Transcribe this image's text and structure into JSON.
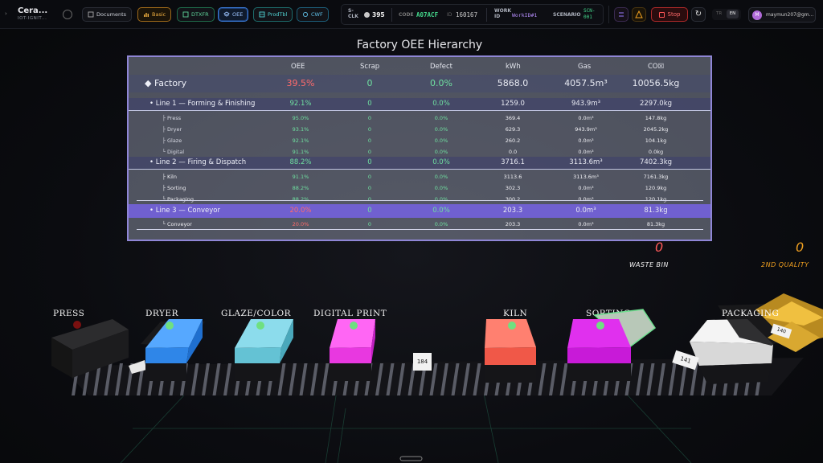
{
  "topbar": {
    "app_title": "Cera...",
    "app_subtitle": "IOT-IGNIT...",
    "buttons": {
      "documents": "Documents",
      "basic": "Basic",
      "dtxfr": "DTXFR",
      "oee": "OEE",
      "prodtbl": "ProdTbl",
      "cwf": "CWF"
    },
    "sclk_label": "S-\nCLK",
    "sclk_value": "395",
    "code_label": "CODE",
    "code_value": "A07ACF",
    "id_label": "ID",
    "id_value": "160167",
    "work_label": "WORK\nID",
    "work_value": "WorkID#1",
    "scenario_label": "SCENARIO",
    "scenario_value": "SCN-\n001",
    "stop_label": "Stop",
    "lang_tr": "TR",
    "lang_en": "EN",
    "avatar_initial": "M",
    "user_email": "maymun207@gm..."
  },
  "oee_table": {
    "title": "Factory OEE Hierarchy",
    "headers": [
      "OEE",
      "Scrap",
      "Defect",
      "kWh",
      "Gas",
      "CO☒"
    ],
    "rows": [
      {
        "kind": "factory",
        "name": "◆ Factory",
        "oee": "39.5%",
        "scrap": "0",
        "defect": "0.0%",
        "kwh": "5868.0",
        "gas": "4057.5m³",
        "co": "10056.5kg"
      },
      {
        "kind": "line",
        "name": "• Line 1 — Forming & Finishing",
        "oee": "92.1%",
        "scrap": "0",
        "defect": "0.0%",
        "kwh": "1259.0",
        "gas": "943.9m³",
        "co": "2297.0kg"
      },
      {
        "kind": "station",
        "name": "├ Press",
        "oee": "95.0%",
        "scrap": "0",
        "defect": "0.0%",
        "kwh": "369.4",
        "gas": "0.0m³",
        "co": "147.8kg"
      },
      {
        "kind": "station",
        "name": "├ Dryer",
        "oee": "93.1%",
        "scrap": "0",
        "defect": "0.0%",
        "kwh": "629.3",
        "gas": "943.9m³",
        "co": "2045.2kg"
      },
      {
        "kind": "station",
        "name": "├ Glaze",
        "oee": "92.1%",
        "scrap": "0",
        "defect": "0.0%",
        "kwh": "260.2",
        "gas": "0.0m³",
        "co": "104.1kg"
      },
      {
        "kind": "station",
        "name": "└ Digital",
        "oee": "91.1%",
        "scrap": "0",
        "defect": "0.0%",
        "kwh": "0.0",
        "gas": "0.0m³",
        "co": "0.0kg"
      },
      {
        "kind": "line",
        "name": "• Line 2 — Firing & Dispatch",
        "oee": "88.2%",
        "scrap": "0",
        "defect": "0.0%",
        "kwh": "3716.1",
        "gas": "3113.6m³",
        "co": "7402.3kg"
      },
      {
        "kind": "station",
        "name": "├ Kiln",
        "oee": "91.1%",
        "scrap": "0",
        "defect": "0.0%",
        "kwh": "3113.6",
        "gas": "3113.6m³",
        "co": "7161.3kg"
      },
      {
        "kind": "station",
        "name": "├ Sorting",
        "oee": "88.2%",
        "scrap": "0",
        "defect": "0.0%",
        "kwh": "302.3",
        "gas": "0.0m³",
        "co": "120.9kg"
      },
      {
        "kind": "station",
        "name": "└ Packaging",
        "oee": "88.2%",
        "scrap": "0",
        "defect": "0.0%",
        "kwh": "300.2",
        "gas": "0.0m³",
        "co": "120.1kg"
      },
      {
        "kind": "line",
        "name": "• Line 3 — Conveyor",
        "oee": "20.0%",
        "scrap": "0",
        "defect": "0.0%",
        "kwh": "203.3",
        "gas": "0.0m³",
        "co": "81.3kg"
      },
      {
        "kind": "station",
        "name": "└ Conveyor",
        "oee": "20.0%",
        "scrap": "0",
        "defect": "0.0%",
        "kwh": "203.3",
        "gas": "0.0m³",
        "co": "81.3kg"
      }
    ]
  },
  "scene": {
    "waste_bin_count": "0",
    "waste_bin_label": "WASTE BIN",
    "second_quality_count": "0",
    "second_quality_label": "2ND QUALITY",
    "stations": [
      "PRESS",
      "DRYER",
      "GLAZE/COLOR",
      "DIGITAL PRINT",
      "KILN",
      "SORTING",
      "PACKAGING"
    ],
    "tile_counter_1": "184",
    "tile_counter_2": "141",
    "tile_counter_3": "140"
  },
  "colors": {
    "oee_red": "#ff6b6b",
    "oee_green": "#6fe0a0",
    "highlight_line3": "#6f5fd0",
    "press": "#1c1c1c",
    "dryer": "#3a8fe8",
    "glaze": "#6cc8d8",
    "digital": "#ef3fe8",
    "kiln": "#f26050",
    "sorting": "#cc22dd",
    "packaging": "#f2f2f2",
    "waste": "#ff5a5a",
    "second": "#f0a020"
  }
}
